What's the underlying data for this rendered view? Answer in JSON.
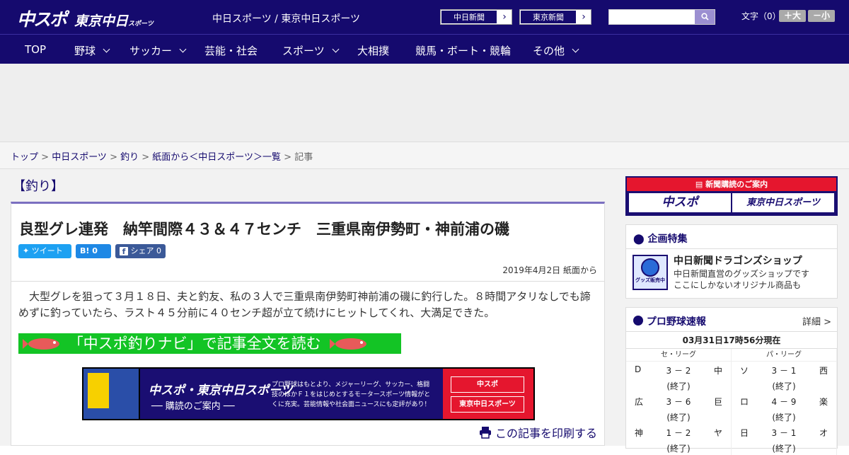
{
  "header": {
    "logo_a": "中スポ",
    "logo_b": "東京中日",
    "logo_c": "スポーツ",
    "site_name": "中日スポーツ / 東京中日スポーツ",
    "paper_btn1": "中日新聞",
    "paper_btn2": "東京新聞",
    "arrow": "›",
    "font_size_label": "文字（0）",
    "font_up": "＋大",
    "font_down": "－小",
    "search_placeholder": ""
  },
  "nav": {
    "items": [
      "TOP",
      "野球",
      "サッカー",
      "芸能・社会",
      "スポーツ",
      "大相撲",
      "競馬・ボート・競輪",
      "その他"
    ]
  },
  "breadcrumb": {
    "items": [
      "トップ",
      "中日スポーツ",
      "釣り",
      "紙面から＜中日スポーツ＞一覧"
    ],
    "current": "記事",
    "sep": " > "
  },
  "article": {
    "category": "【釣り】",
    "headline": "良型グレ連発　納竿間際４３＆４７センチ　三重県南伊勢町・神前浦の磯",
    "tweet": "ツイート",
    "hatena": "B! 0",
    "share": "シェア 0",
    "date": "2019年4月2日 紙面から",
    "lead": "　大型グレを狙って３月１８日、夫と釣友、私の３人で三重県南伊勢町神前浦の磯に釣行した。８時間アタリなしでも諦めずに釣っていたら、ラスト４５分前に４０センチ超が立て続けにヒットしてくれ、大満足できた。",
    "navi_link": "「中スポ釣りナビ」で記事全文を読む",
    "print": "この記事を印刷する"
  },
  "banner": {
    "title": "中スポ・東京中日スポーツ",
    "subtitle": "── 購読のご案内 ──",
    "text": "プロ野球はもとより、メジャーリーグ、サッカー、格闘技のほかＦ１をはじめとするモータースポーツ情報がとくに充実。芸能情報や社会面ニュースにも定評があり！",
    "btn1": "中スポ",
    "btn2": "東京中日スポーツ"
  },
  "sidebar": {
    "subscribe": {
      "header": "新聞購読のご案内",
      "btn1": "中スポ",
      "btn2": "東京中日スポーツ"
    },
    "feature": {
      "title": "企画特集",
      "shop_title": "中日新聞ドラゴンズショップ",
      "shop_desc1": "中日新聞直営のグッズショップです",
      "shop_desc2": "ここにしかないオリジナル商品も",
      "shop_img_label": "グッズ販売中"
    },
    "baseball": {
      "title": "プロ野球速報",
      "more": "詳細 >",
      "as_of": "03月31日17時56分現在",
      "central": "セ・リーグ",
      "pacific": "パ・リーグ",
      "central_games": [
        {
          "home": "D",
          "score": "3 － 2",
          "away": "中",
          "status": "(終了)"
        },
        {
          "home": "広",
          "score": "3 － 6",
          "away": "巨",
          "status": "(終了)"
        },
        {
          "home": "神",
          "score": "1 － 2",
          "away": "ヤ",
          "status": "(終了)"
        }
      ],
      "pacific_games": [
        {
          "home": "ソ",
          "score": "3 － 1",
          "away": "西",
          "status": "(終了)"
        },
        {
          "home": "ロ",
          "score": "4 － 9",
          "away": "楽",
          "status": "(終了)"
        },
        {
          "home": "日",
          "score": "3 － 1",
          "away": "オ",
          "status": "(終了)"
        }
      ]
    }
  },
  "colors": {
    "brand": "#150a6e",
    "accent": "#e5162e",
    "navi_green": "#13c425"
  }
}
